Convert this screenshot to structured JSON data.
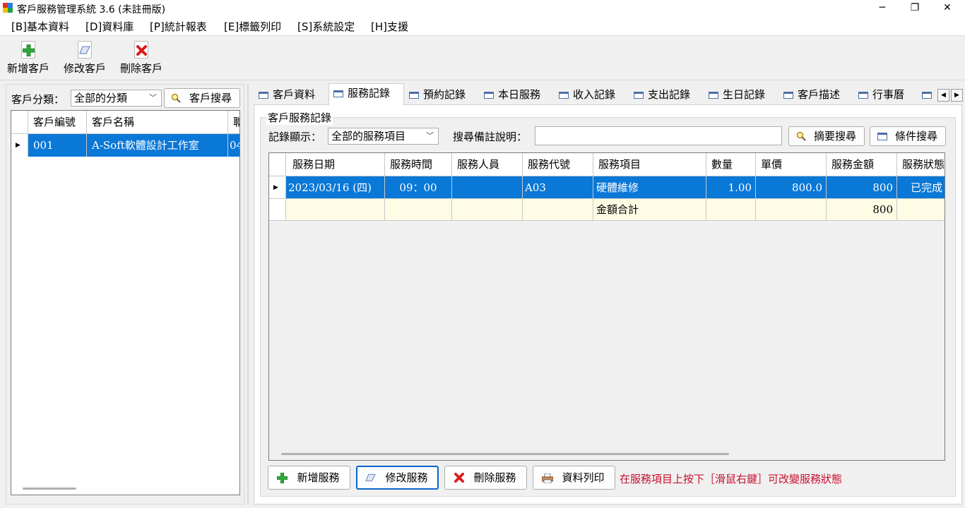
{
  "window": {
    "title": "客戶服務管理系統 3.6 (未註冊版)",
    "minimize_label": "─",
    "maximize_label": "❐",
    "close_label": "✕"
  },
  "menu": [
    "[B]基本資料",
    "[D]資料庫",
    "[P]統計報表",
    "[E]標籤列印",
    "[S]系統設定",
    "[H]支援"
  ],
  "toolbar": {
    "add": "新增客戶",
    "edit": "修改客戶",
    "delete": "刪除客戶"
  },
  "left": {
    "category_label": "客戶分類：",
    "category_value": "全部的分類",
    "search_button": "客戶搜尋",
    "columns": [
      "客戶編號",
      "客戶名稱",
      "聯"
    ],
    "rows": [
      {
        "id": "001",
        "name": "A-Soft軟體設計工作室",
        "extra": "04"
      }
    ]
  },
  "tabs": [
    "客戶資料",
    "服務記錄",
    "預約記錄",
    "本日服務",
    "收入記錄",
    "支出記錄",
    "生日記錄",
    "客戶描述",
    "行事曆",
    ""
  ],
  "active_tab": "服務記錄",
  "service": {
    "group_title": "客戶服務記錄",
    "show_label": "記錄顯示：",
    "show_value": "全部的服務項目",
    "remark_label": "搜尋備註說明：",
    "remark_value": "",
    "summary_search": "摘要搜尋",
    "condition_search": "條件搜尋",
    "columns": [
      "服務日期",
      "服務時間",
      "服務人員",
      "服務代號",
      "服務項目",
      "數量",
      "單價",
      "服務金額",
      "服務狀態"
    ],
    "rows": [
      {
        "date": "2023/03/16 (四)",
        "time": "09：00",
        "staff": "",
        "code": "A03",
        "item": "硬體維修",
        "qty": "1.00",
        "price": "800.0",
        "amount": "800",
        "status": "已完成"
      }
    ],
    "total": {
      "label": "金額合計",
      "amount": "800"
    },
    "buttons": {
      "add": "新增服務",
      "edit": "修改服務",
      "delete": "刪除服務",
      "print": "資料列印"
    },
    "hint": "在服務項目上按下［滑鼠右鍵］可改變服務狀態"
  }
}
